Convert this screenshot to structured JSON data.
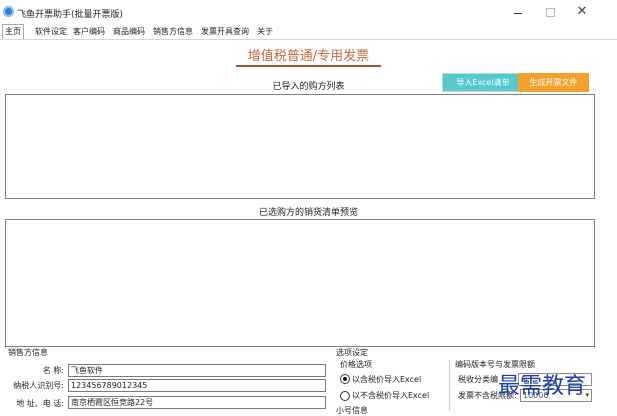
{
  "window": {
    "title": "飞鱼开票助手(批量开票版)",
    "controls": {
      "minimize": "—",
      "maximize": "□",
      "close": "✕"
    }
  },
  "tabs": [
    "主页",
    "软件设定",
    "客户编码",
    "商品编码",
    "销售方信息",
    "发票开具查询",
    "关于"
  ],
  "active_tab": "主页",
  "header": {
    "title": "增值税普通/专用发票",
    "import_button": "导入Excel清单",
    "generate_button": "生成开票文件"
  },
  "sections": {
    "buyers_list": "已导入的购方列表",
    "preview": "已选购方的销货清单预览"
  },
  "seller": {
    "group_title": "销售方信息",
    "name_label": "名 称:",
    "name_value": "飞鱼软件",
    "tax_id_label": "纳税人识别号:",
    "tax_id_value": "123456789012345",
    "address_label": "地 址、电 话:",
    "address_value": "南京栖霞区恒竞路22号"
  },
  "options": {
    "group_title": "选项设定",
    "price_group": "价格选项",
    "radio_incl": "以含税价导入Excel",
    "radio_excl": "以不含税价导入Excel",
    "items_group": "小号信息",
    "version_group": "编码版本号与发票限额",
    "tax_class_label": "税收分类编",
    "tax_class_value": "&...",
    "limit_label": "发票不含税限额:",
    "limit_value": "10000"
  },
  "watermark": "最需教育",
  "colors": {
    "accent_title": "#c46a3d",
    "import_btn": "#56c9cf",
    "generate_btn": "#f2a12c",
    "watermark": "#1a3fa8"
  }
}
